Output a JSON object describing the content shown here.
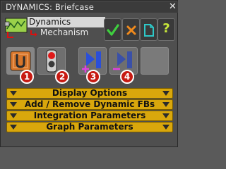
{
  "window": {
    "title": "DYNAMICS: Briefcase",
    "close_glyph": "✕"
  },
  "tree": {
    "icon": "dynamics-tree-icon",
    "selected": "Dynamics",
    "child": "Mechanism"
  },
  "toolbar": {
    "confirm": {
      "icon": "checkmark-icon",
      "color": "#3fcf3f"
    },
    "cancel": {
      "icon": "x-icon",
      "color": "#f08a1c"
    },
    "new": {
      "icon": "new-document-icon",
      "color": "#2ec8c8"
    },
    "help": {
      "icon": "question-mark-icon",
      "glyph": "?",
      "color": "#c8e83a"
    }
  },
  "tools": [
    {
      "icon": "rigid-body-icon",
      "badge": "1"
    },
    {
      "icon": "traffic-light-icon",
      "badge": "2"
    },
    {
      "icon": "add-flexible-body-icon",
      "badge": "3"
    },
    {
      "icon": "remove-flexible-body-icon",
      "badge": "4"
    },
    {
      "icon": "empty-slot",
      "badge": ""
    }
  ],
  "sections": [
    {
      "label": "Display Options"
    },
    {
      "label": "Add / Remove Dynamic FBs"
    },
    {
      "label": "Integration Parameters"
    },
    {
      "label": "Graph Parameters"
    }
  ],
  "colors": {
    "section_bg": "#d9a70c",
    "badge_bg": "#c71a12",
    "panel_bg": "#4f4f4f"
  }
}
